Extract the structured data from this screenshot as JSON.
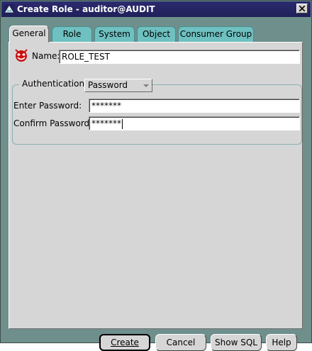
{
  "window": {
    "title": "Create Role - auditor@AUDIT"
  },
  "tabs": [
    {
      "label": "General",
      "active": true
    },
    {
      "label": "Role",
      "active": false
    },
    {
      "label": "System",
      "active": false
    },
    {
      "label": "Object",
      "active": false
    },
    {
      "label": "Consumer Group",
      "active": false
    }
  ],
  "form": {
    "name_label": "Name:",
    "name_value": "ROLE_TEST",
    "auth_label": "Authentication",
    "auth_value": "Password",
    "enter_password_label": "Enter Password:",
    "enter_password_value": "*******",
    "confirm_password_label": "Confirm Password:",
    "confirm_password_value": "*******"
  },
  "buttons": {
    "create_label": "Create",
    "cancel_label": "Cancel",
    "show_sql_label": "Show SQL",
    "help_label": "Help"
  },
  "icons": {
    "window_icon": "oracle-tree-icon",
    "role_icon": "role-mask-icon",
    "close_icon": "close-icon",
    "dropdown_icon": "chevron-down-icon"
  },
  "colors": {
    "titlebar": "#20205a",
    "frame": "#6f8f8c",
    "panel": "#d6d6d6",
    "tab_inactive": "#6fc0c0",
    "role_icon_red": "#cc1111"
  }
}
